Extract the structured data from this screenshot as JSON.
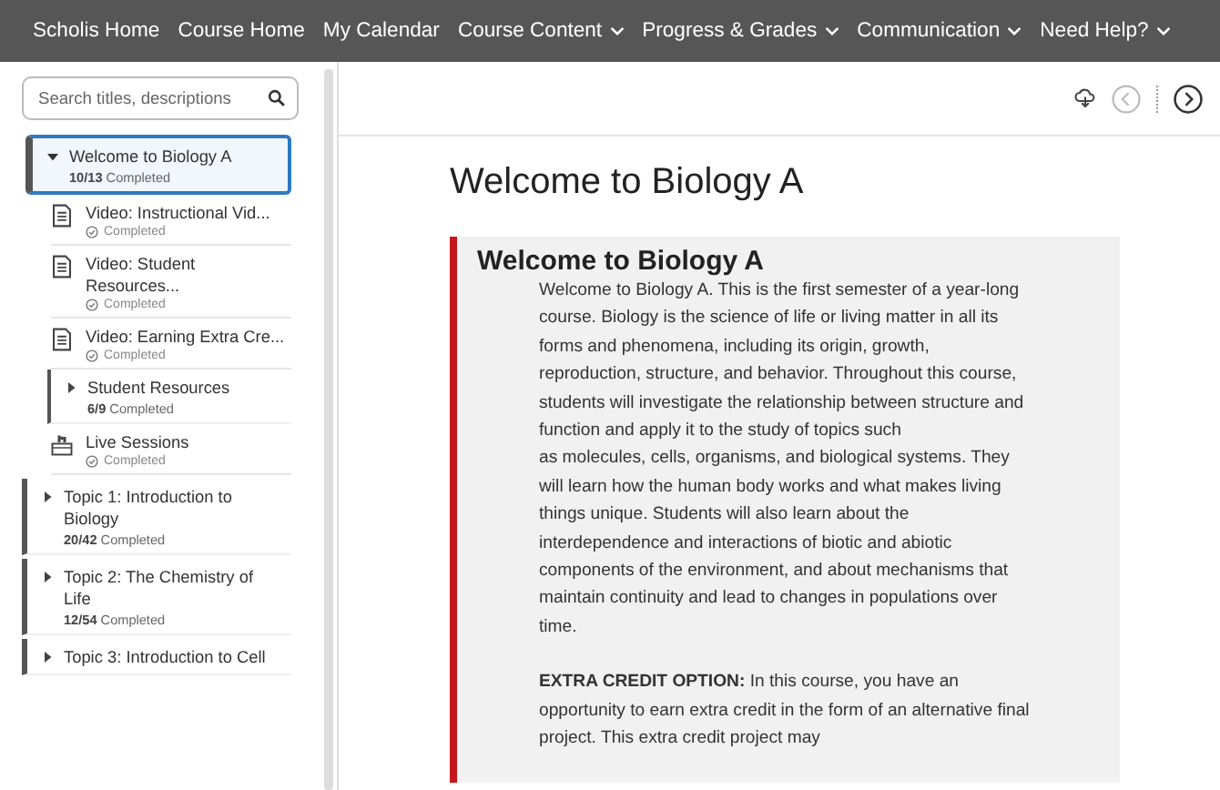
{
  "nav": {
    "items": [
      {
        "label": "Scholis Home",
        "dropdown": false
      },
      {
        "label": "Course Home",
        "dropdown": false
      },
      {
        "label": "My Calendar",
        "dropdown": false
      },
      {
        "label": "Course Content",
        "dropdown": true
      },
      {
        "label": "Progress & Grades",
        "dropdown": true
      },
      {
        "label": "Communication",
        "dropdown": true
      },
      {
        "label": "Need Help?",
        "dropdown": true
      }
    ]
  },
  "sidebar": {
    "search": {
      "placeholder": "Search titles, descriptions"
    },
    "items": [
      {
        "kind": "module",
        "title": "Welcome to Biology A",
        "progress": "10/13",
        "status": "Completed",
        "selected": true,
        "expanded": true,
        "children": [
          {
            "kind": "document",
            "title": "Video: Instructional Vid...",
            "status": "Completed"
          },
          {
            "kind": "document",
            "title": "Video: Student Resources...",
            "status": "Completed"
          },
          {
            "kind": "document",
            "title": "Video: Earning Extra Cre...",
            "status": "Completed"
          },
          {
            "kind": "module",
            "title": "Student Resources",
            "progress": "6/9",
            "status": "Completed",
            "expanded": false
          },
          {
            "kind": "live",
            "title": "Live Sessions",
            "status": "Completed"
          }
        ]
      },
      {
        "kind": "module",
        "title": "Topic 1: Introduction to Biology",
        "progress": "20/42",
        "status": "Completed",
        "selected": false,
        "expanded": false
      },
      {
        "kind": "module",
        "title": "Topic 2: The Chemistry of Life",
        "progress": "12/54",
        "status": "Completed",
        "selected": false,
        "expanded": false
      },
      {
        "kind": "module",
        "title": "Topic 3: Introduction to Cell",
        "selected": false,
        "expanded": false
      }
    ]
  },
  "content": {
    "title": "Welcome to Biology A",
    "panel_heading": "Welcome to Biology A",
    "paragraphs": [
      "Welcome to Biology A. This is the first semester of a year-long course. Biology is the science of life or living matter in all its forms and phenomena, including its origin, growth, reproduction, structure, and behavior. Throughout this course, students will investigate the relationship between structure and function and apply it to the study of topics such",
      "as molecules, cells, organisms, and biological systems. They will learn how the human body works and what makes living things unique. Students will also learn about the interdependence and interactions of biotic and abiotic components of the environment, and about mechanisms that maintain continuity and lead to changes in populations over time.",
      "**EXTRA CREDIT OPTION:** In this course, you have an opportunity to earn extra credit in the form of an alternative final project. This extra credit project may"
    ]
  }
}
